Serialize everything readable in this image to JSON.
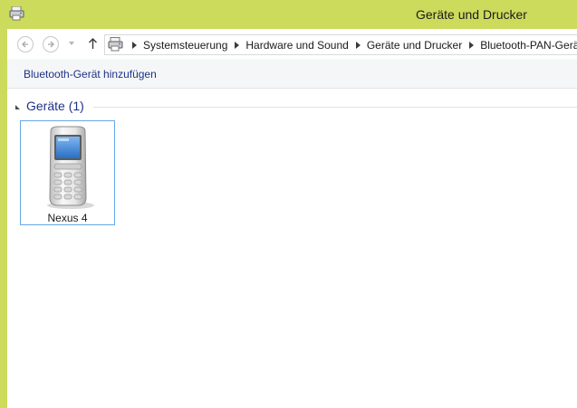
{
  "window": {
    "title": "Geräte und Drucker"
  },
  "navigation": {
    "back_icon": "back-arrow-icon",
    "forward_icon": "forward-arrow-icon",
    "up_icon": "up-arrow-icon",
    "breadcrumbs": [
      "Systemsteuerung",
      "Hardware und Sound",
      "Geräte und Drucker",
      "Bluetooth-PAN-Geräte"
    ]
  },
  "toolbar": {
    "add_bluetooth_device": "Bluetooth-Gerät hinzufügen"
  },
  "devices_group": {
    "title": "Geräte (1)",
    "items": [
      {
        "label": "Nexus 4",
        "icon": "mobile-phone-icon"
      }
    ]
  }
}
